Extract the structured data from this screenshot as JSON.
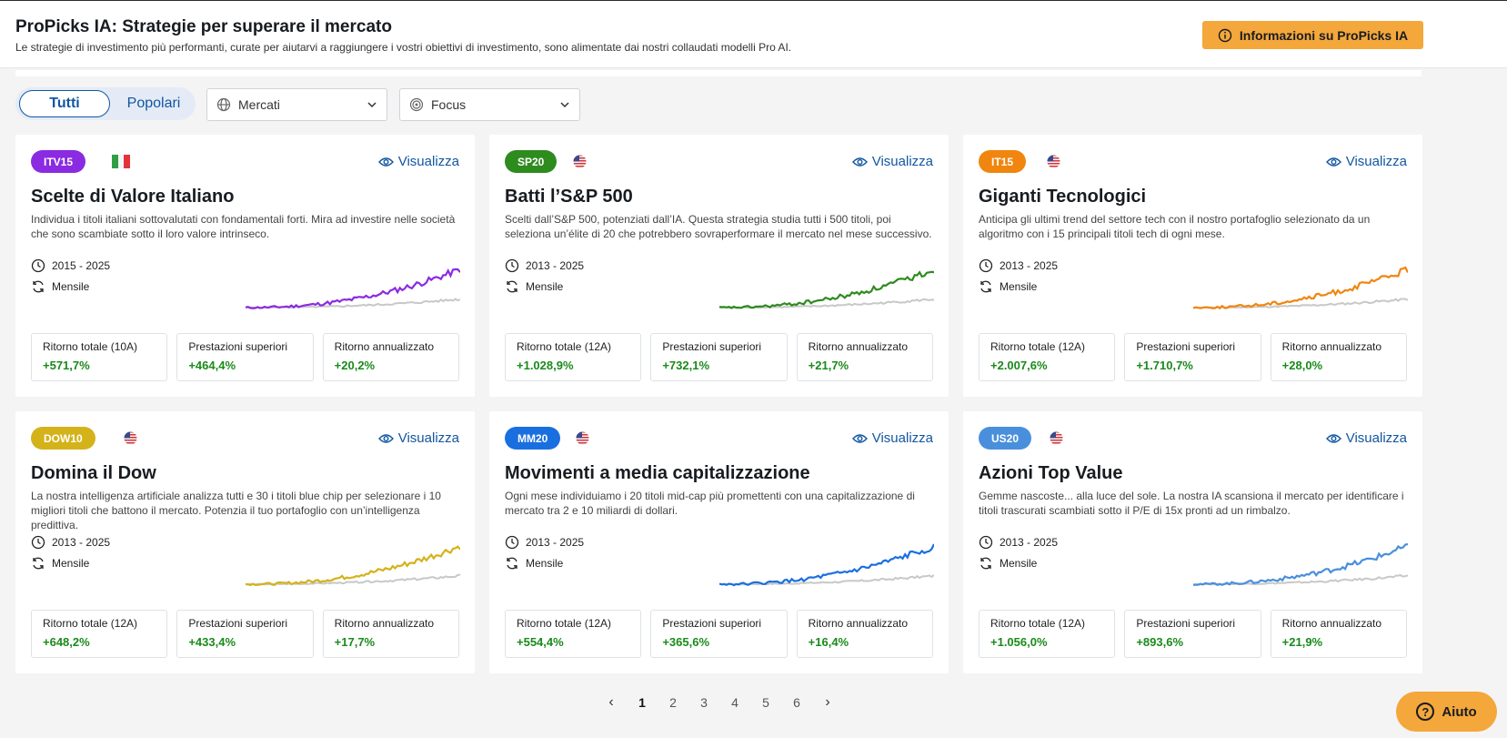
{
  "header": {
    "title": "ProPicks IA: Strategie per superare il mercato",
    "subtitle": "Le strategie di investimento più performanti, curate per aiutarvi a raggiungere i vostri obiettivi di investimento, sono alimentate dai nostri collaudati modelli Pro AI.",
    "info_button": "Informazioni su ProPicks IA"
  },
  "filters": {
    "toggle_all": "Tutti",
    "toggle_popular": "Popolari",
    "markets": "Mercati",
    "focus": "Focus"
  },
  "view_label": "Visualizza",
  "cards": [
    {
      "badge": "ITV15",
      "badge_color": "#8a2be2",
      "flag": "it-flag",
      "title": "Scelte di Valore Italiano",
      "description": "Individua i titoli italiani sottovalutati con fondamentali forti. Mira ad investire nelle società che sono scambiate sotto il loro valore intrinseco.",
      "period": "2015 - 2025",
      "frequency": "Mensile",
      "line_color": "#8a2be2",
      "stats": [
        {
          "label": "Ritorno totale (10A)",
          "value": "+571,7%"
        },
        {
          "label": "Prestazioni superiori",
          "value": "+464,4%"
        },
        {
          "label": "Ritorno annualizzato",
          "value": "+20,2%"
        }
      ]
    },
    {
      "badge": "SP20",
      "badge_color": "#2e8b1e",
      "flag": "us-flag",
      "title": "Batti l’S&P 500",
      "description": "Scelti dall’S&P 500, potenziati dall’IA. Questa strategia studia tutti i 500 titoli, poi seleziona un’élite di 20 che potrebbero sovraperformare il mercato nel mese successivo.",
      "period": "2013 - 2025",
      "frequency": "Mensile",
      "line_color": "#2e8b1e",
      "stats": [
        {
          "label": "Ritorno totale (12A)",
          "value": "+1.028,9%"
        },
        {
          "label": "Prestazioni superiori",
          "value": "+732,1%"
        },
        {
          "label": "Ritorno annualizzato",
          "value": "+21,7%"
        }
      ]
    },
    {
      "badge": "IT15",
      "badge_color": "#f0860f",
      "flag": "us-flag",
      "title": "Giganti Tecnologici",
      "description": "Anticipa gli ultimi trend del settore tech con il nostro portafoglio selezionato da un algoritmo con i 15 principali titoli tech di ogni mese.",
      "period": "2013 - 2025",
      "frequency": "Mensile",
      "line_color": "#f0860f",
      "stats": [
        {
          "label": "Ritorno totale (12A)",
          "value": "+2.007,6%"
        },
        {
          "label": "Prestazioni superiori",
          "value": "+1.710,7%"
        },
        {
          "label": "Ritorno annualizzato",
          "value": "+28,0%"
        }
      ]
    },
    {
      "badge": "DOW10",
      "badge_color": "#d4b21a",
      "flag": "us-flag",
      "title": "Domina il Dow",
      "description": "La nostra intelligenza artificiale analizza tutti e 30 i titoli blue chip per selezionare i 10 migliori titoli che battono il mercato. Potenzia il tuo portafoglio con un’intelligenza predittiva.",
      "period": "2013 - 2025",
      "frequency": "Mensile",
      "line_color": "#d4b21a",
      "stats": [
        {
          "label": "Ritorno totale (12A)",
          "value": "+648,2%"
        },
        {
          "label": "Prestazioni superiori",
          "value": "+433,4%"
        },
        {
          "label": "Ritorno annualizzato",
          "value": "+17,7%"
        }
      ]
    },
    {
      "badge": "MM20",
      "badge_color": "#1a6fe0",
      "flag": "us-flag",
      "title": "Movimenti a media capitalizzazione",
      "description": "Ogni mese individuiamo i 20 titoli mid-cap più promettenti con una capitalizzazione di mercato tra 2 e 10 miliardi di dollari.",
      "period": "2013 - 2025",
      "frequency": "Mensile",
      "line_color": "#1a6fe0",
      "stats": [
        {
          "label": "Ritorno totale (12A)",
          "value": "+554,4%"
        },
        {
          "label": "Prestazioni superiori",
          "value": "+365,6%"
        },
        {
          "label": "Ritorno annualizzato",
          "value": "+16,4%"
        }
      ]
    },
    {
      "badge": "US20",
      "badge_color": "#4a8fdc",
      "flag": "us-flag",
      "title": "Azioni Top Value",
      "description": "Gemme nascoste... alla luce del sole. La nostra IA scansiona il mercato per identificare i titoli trascurati scambiati sotto il P/E di 15x pronti ad un rimbalzo.",
      "period": "2013 - 2025",
      "frequency": "Mensile",
      "line_color": "#4a8fdc",
      "stats": [
        {
          "label": "Ritorno totale (12A)",
          "value": "+1.056,0%"
        },
        {
          "label": "Prestazioni superiori",
          "value": "+893,6%"
        },
        {
          "label": "Ritorno annualizzato",
          "value": "+21,9%"
        }
      ]
    }
  ],
  "pagination": {
    "pages": [
      "1",
      "2",
      "3",
      "4",
      "5",
      "6"
    ],
    "current": "1"
  },
  "help_label": "Aiuto"
}
